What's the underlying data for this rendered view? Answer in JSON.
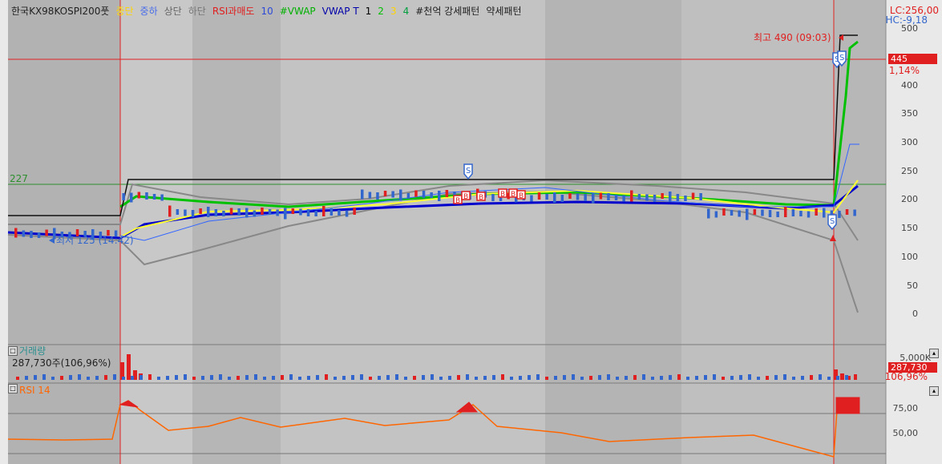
{
  "header": {
    "legend": [
      {
        "text": "한국KX98KOSPI200풋",
        "color": "#222222"
      },
      {
        "text": "중단",
        "color": "#ffd400"
      },
      {
        "text": "중하",
        "color": "#4a6ee8"
      },
      {
        "text": "상단",
        "color": "#666666"
      },
      {
        "text": "하단",
        "color": "#777777"
      },
      {
        "text": "RSI과매도",
        "color": "#e02020"
      },
      {
        "text": "10",
        "color": "#2e4bd8"
      },
      {
        "text": "#VWAP",
        "color": "#00b000"
      },
      {
        "text": "VWAP T",
        "color": "#0000aa"
      },
      {
        "text": "1",
        "color": "#000000"
      },
      {
        "text": "2",
        "color": "#00c000"
      },
      {
        "text": "3",
        "color": "#ffd400"
      },
      {
        "text": "4",
        "color": "#00a040"
      },
      {
        "text": "#천억 강세패턴",
        "color": "#222222"
      },
      {
        "text": "약세패턴",
        "color": "#222222"
      }
    ],
    "lc_value": "LC:256,00",
    "hc_value": "HC:-9,18"
  },
  "annotations": {
    "high_label": "최고 490 (09:03)",
    "low_label": "최저 125 (14:42)",
    "left_price_label": "227"
  },
  "price_axis": {
    "ticks": [
      "500",
      "450",
      "400",
      "350",
      "300",
      "250",
      "200",
      "150",
      "100",
      "50",
      "0"
    ],
    "current_price": "445",
    "current_change": "1,14%"
  },
  "volume_panel": {
    "title": "거래량",
    "summary": "287,730주(106,96%)",
    "axis_top": "5,000K",
    "current_value": "287,730",
    "current_pct": "106,96%"
  },
  "rsi_panel": {
    "title": "RSI 14",
    "ticks": [
      "75,00",
      "50,00"
    ]
  },
  "colors": {
    "background": "#c3c3c3",
    "band": "#888888",
    "vwap": "#00c000",
    "ma": "#0000cc",
    "mid": "#ffff33",
    "up": "#e02020",
    "down": "#3366cc",
    "rsi": "#ff6600"
  }
}
